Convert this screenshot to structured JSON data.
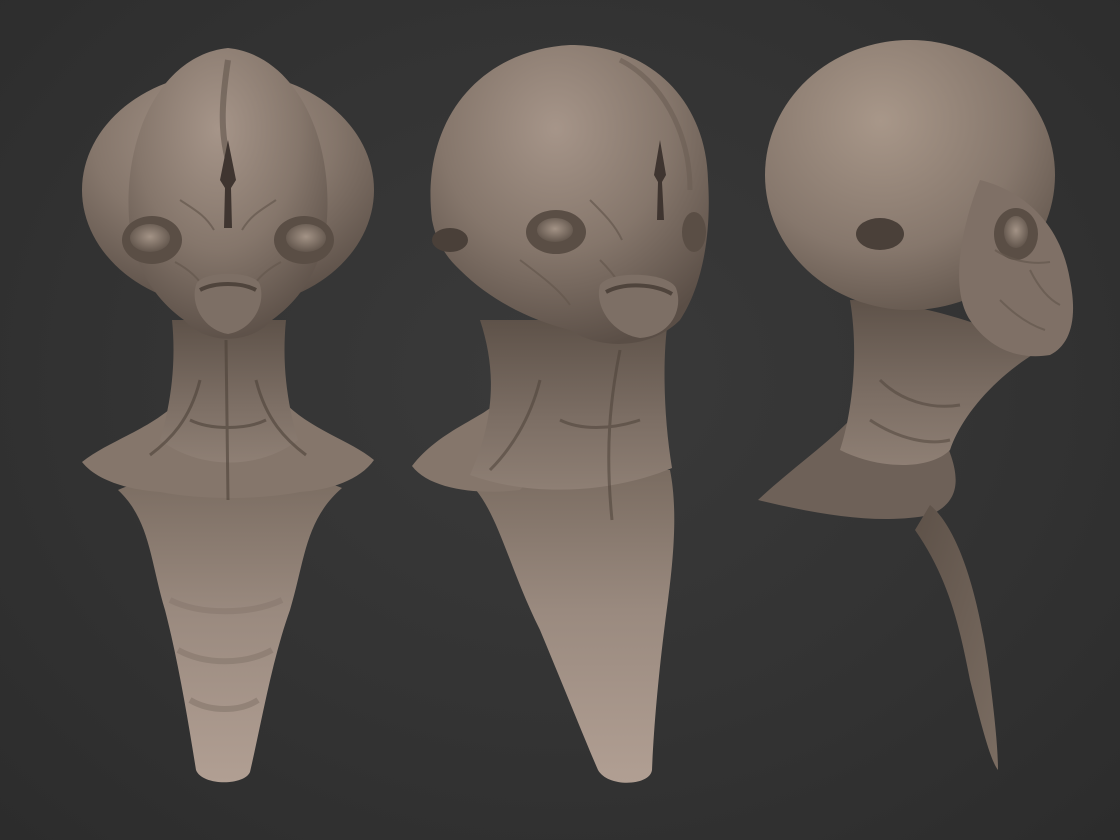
{
  "viewport": {
    "background_color": "#333333",
    "material_color": "#8c7d71",
    "views": [
      {
        "view": "front",
        "icon": "alien-bust-front"
      },
      {
        "view": "three-quarter",
        "icon": "alien-bust-three-quarter"
      },
      {
        "view": "side",
        "icon": "alien-bust-side"
      }
    ]
  }
}
